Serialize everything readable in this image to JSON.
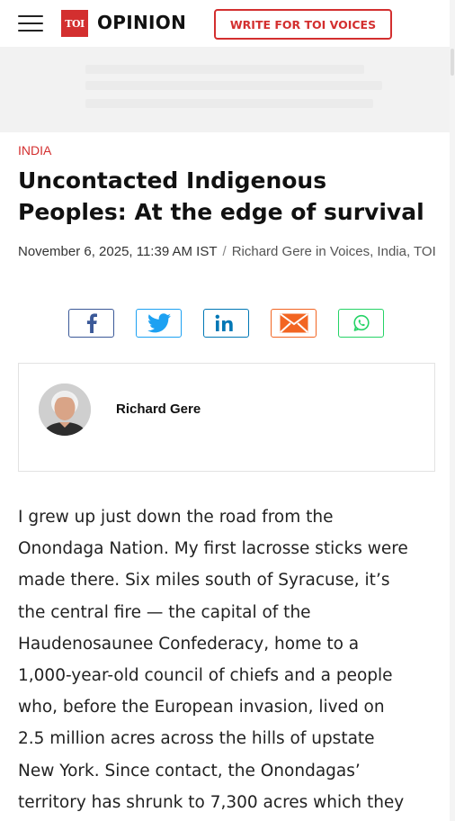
{
  "header": {
    "logo_text": "TOI",
    "section_title": "OPINION",
    "cta_label": "WRITE FOR TOI VOICES"
  },
  "article": {
    "category": "INDIA",
    "headline": "Uncontacted Indigenous Peoples: At the edge of survival",
    "date": "November 6, 2025, 11:39 AM IST",
    "separator": "/",
    "byline": "Richard Gere in Voices, India, TOI",
    "author_name": "Richard Gere",
    "body_lines": [
      "I grew up just down the road from the",
      "Onondaga Nation. My first lacrosse sticks were",
      "made there. Six miles south of Syracuse, it’s",
      "the central fire — the capital of the",
      "Haudenosaunee Confederacy, home to a",
      "1,000-year-old council of chiefs and a people",
      "who, before the European invasion, lived on",
      "2.5 million acres across the hills of upstate",
      "New York. Since contact, the Onondagas’",
      "territory has shrunk to 7,300 acres which they"
    ]
  },
  "share": {
    "buttons": [
      {
        "name": "facebook",
        "icon": "facebook-icon",
        "color": "#3b5998"
      },
      {
        "name": "twitter",
        "icon": "twitter-icon",
        "color": "#1da1f2"
      },
      {
        "name": "linkedin",
        "icon": "linkedin-icon",
        "color": "#0077b5"
      },
      {
        "name": "email",
        "icon": "mail-icon",
        "color": "#f26522"
      },
      {
        "name": "whatsapp",
        "icon": "whatsapp-icon",
        "color": "#25d366"
      }
    ]
  },
  "colors": {
    "accent": "#d32f2f",
    "text": "#222222",
    "ad_background": "#f2f2f2"
  }
}
